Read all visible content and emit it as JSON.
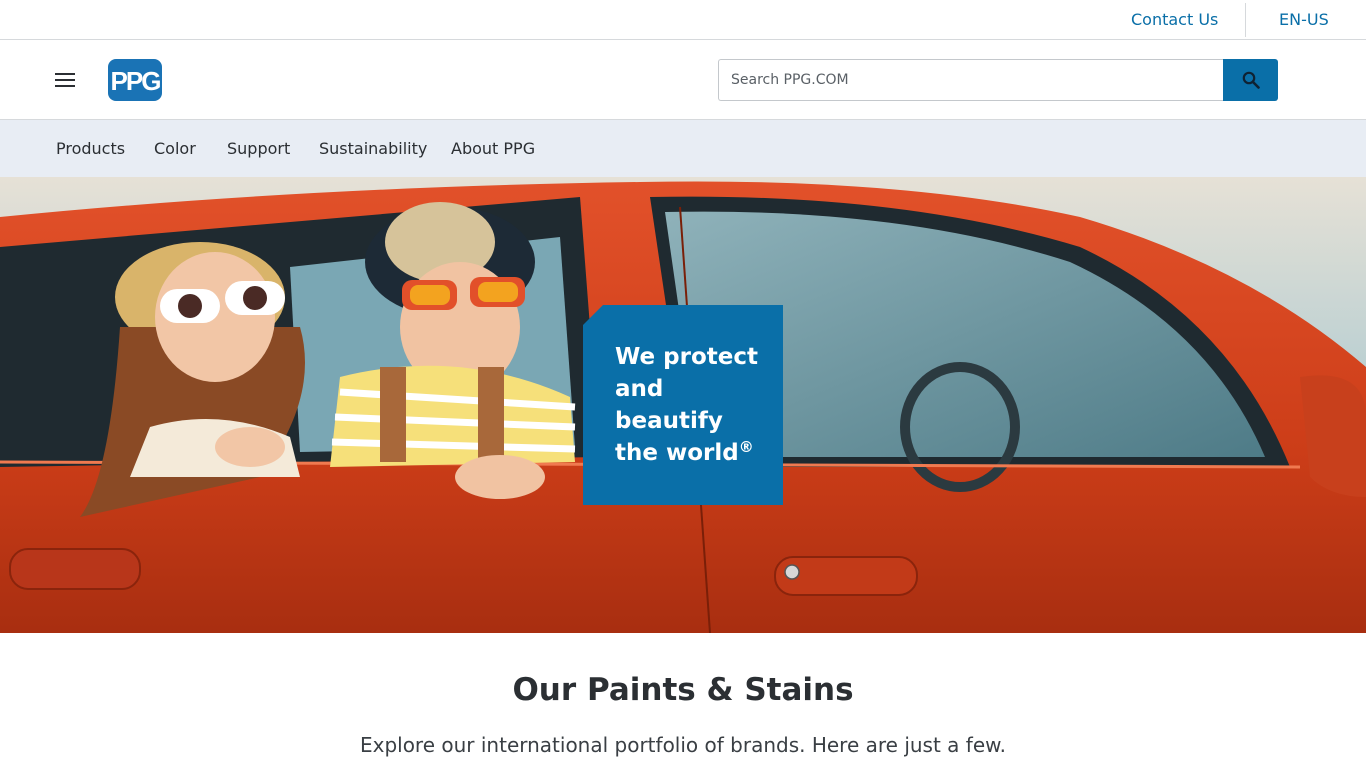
{
  "utility": {
    "contact_label": "Contact Us",
    "language_label": "EN-US"
  },
  "header": {
    "menu_icon": "hamburger-menu-icon",
    "logo_text": "PPG",
    "search": {
      "placeholder": "Search PPG.COM",
      "value": "",
      "button_icon": "search-icon"
    }
  },
  "nav": {
    "items": [
      {
        "label": "Products"
      },
      {
        "label": "Color"
      },
      {
        "label": "Support"
      },
      {
        "label": "Sustainability"
      },
      {
        "label": "About PPG"
      }
    ]
  },
  "hero": {
    "callout_text": "We protect and beautify the world",
    "callout_mark": "®"
  },
  "section": {
    "title": "Our Paints & Stains",
    "subtitle": "Explore our international portfolio of brands. Here are just a few."
  },
  "colors": {
    "brand_blue": "#0a6fa8",
    "nav_bg": "#e8edf4",
    "car_red": "#d8401c"
  }
}
